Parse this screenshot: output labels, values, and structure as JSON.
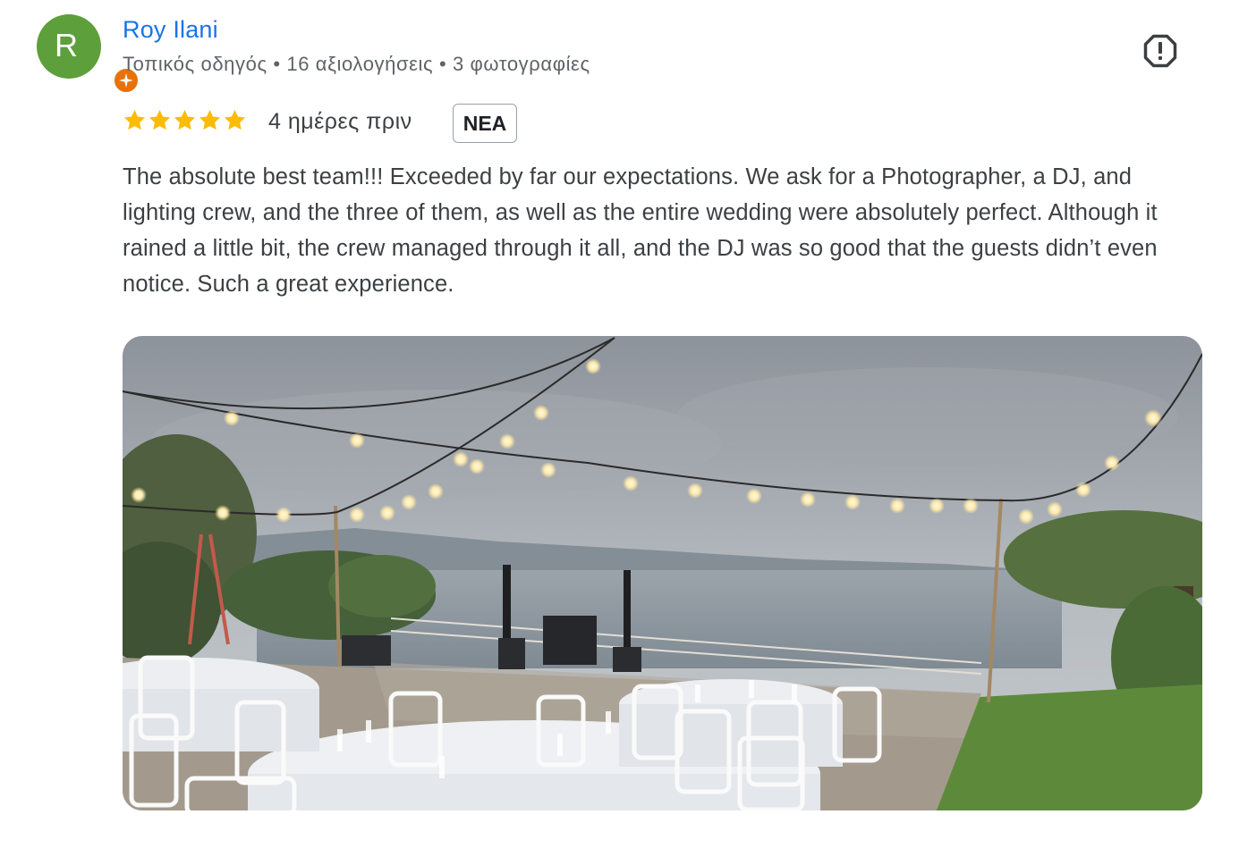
{
  "reviewer": {
    "avatar_letter": "R",
    "avatar_color": "#5d9f3b",
    "badge_color": "#e8710a",
    "badge_icon": "local-guide-star-icon",
    "name": "Roy Ilani",
    "meta": "Τοπικός οδηγός • 16 αξιολογήσεις • 3 φωτογραφίες"
  },
  "review": {
    "rating": 5,
    "star_color": "#fbbc04",
    "time": "4 ημέρες πριν",
    "badge": "NEA",
    "text": "The absolute best team!!! Exceeded by far our expectations. We ask for a Photographer, a DJ, and lighting crew, and the three of them, as well as the entire wedding were absolutely perfect. Although it rained a little bit, the crew managed through it all, and the DJ was so good that the guests didn’t even notice. Such a great experience."
  },
  "actions": {
    "report_icon": "report-flag-icon"
  },
  "photo": {
    "subject": "outdoor wedding reception with string lights and set tables by the sea"
  }
}
